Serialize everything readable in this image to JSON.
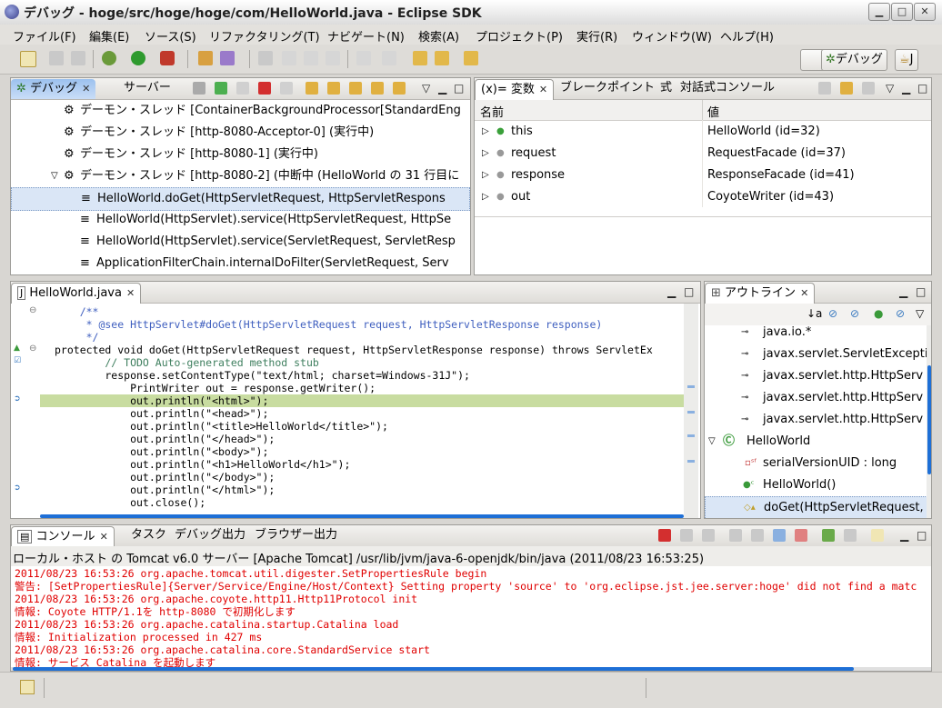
{
  "window": {
    "title": "デバッグ - hoge/src/hoge/hoge/com/HelloWorld.java - Eclipse SDK"
  },
  "menubar": [
    "ファイル(F)",
    "編集(E)",
    "ソース(S)",
    "リファクタリング(T)",
    "ナビゲート(N)",
    "検索(A)",
    "プロジェクト(P)",
    "実行(R)",
    "ウィンドウ(W)",
    "ヘルプ(H)"
  ],
  "perspectives": {
    "debug": "デバッグ",
    "java": "J"
  },
  "debug_view": {
    "tabs": [
      "デバッグ",
      "サーバー"
    ],
    "items": [
      "デーモン・スレッド [ContainerBackgroundProcessor[StandardEng",
      "デーモン・スレッド [http-8080-Acceptor-0] (実行中)",
      "デーモン・スレッド [http-8080-1] (実行中)",
      "デーモン・スレッド [http-8080-2] (中断中 (HelloWorld の 31 行目に",
      "HelloWorld.doGet(HttpServletRequest, HttpServletRespons",
      "HelloWorld(HttpServlet).service(HttpServletRequest, HttpSe",
      "HelloWorld(HttpServlet).service(ServletRequest, ServletResp",
      "ApplicationFilterChain.internalDoFilter(ServletRequest, Serv"
    ]
  },
  "variables_view": {
    "tabs": [
      "(x)= 変数",
      "ブレークポイント",
      "式",
      "対話式コンソール"
    ],
    "columns": [
      "名前",
      "値"
    ],
    "rows": [
      {
        "name": "this",
        "value": "HelloWorld  (id=32)"
      },
      {
        "name": "request",
        "value": "RequestFacade  (id=37)"
      },
      {
        "name": "response",
        "value": "ResponseFacade  (id=41)"
      },
      {
        "name": "out",
        "value": "CoyoteWriter  (id=43)"
      }
    ]
  },
  "editor": {
    "tab": "HelloWorld.java",
    "lines": [
      "    /**",
      "     * @see HttpServlet#doGet(HttpServletRequest request, HttpServletResponse response)",
      "     */",
      "protected void doGet(HttpServletRequest request, HttpServletResponse response) throws ServletEx",
      "        // TODO Auto-generated method stub",
      "        response.setContentType(\"text/html; charset=Windows-31J\");",
      "            PrintWriter out = response.getWriter();",
      "            out.println(\"<html>\");",
      "            out.println(\"<head>\");",
      "            out.println(\"<title>HelloWorld</title>\");",
      "            out.println(\"</head>\");",
      "            out.println(\"<body>\");",
      "            out.println(\"<h1>HelloWorld</h1>\");",
      "            out.println(\"</body>\");",
      "            out.println(\"</html>\");",
      "            out.close();"
    ]
  },
  "outline_view": {
    "tab": "アウトライン",
    "items": [
      "java.io.*",
      "javax.servlet.ServletExcepti",
      "javax.servlet.http.HttpServ",
      "javax.servlet.http.HttpServ",
      "javax.servlet.http.HttpServ",
      "HelloWorld",
      "serialVersionUID : long",
      "HelloWorld()",
      "doGet(HttpServletRequest,"
    ]
  },
  "console_view": {
    "tabs": [
      "コンソール",
      "タスク",
      "デバッグ出力",
      "ブラウザー出力"
    ],
    "header": "ローカル・ホスト の Tomcat v6.0 サーバー [Apache Tomcat] /usr/lib/jvm/java-6-openjdk/bin/java (2011/08/23 16:53:25)",
    "lines": [
      "2011/08/23 16:53:26 org.apache.tomcat.util.digester.SetPropertiesRule begin",
      "警告: [SetPropertiesRule]{Server/Service/Engine/Host/Context} Setting property 'source' to 'org.eclipse.jst.jee.server:hoge' did not find a matc",
      "2011/08/23 16:53:26 org.apache.coyote.http11.Http11Protocol init",
      "情報: Coyote HTTP/1.1を http-8080 で初期化します",
      "2011/08/23 16:53:26 org.apache.catalina.startup.Catalina load",
      "情報: Initialization processed in 427 ms",
      "2011/08/23 16:53:26 org.apache.catalina.core.StandardService start",
      "情報: サービス Catalina を起動します"
    ]
  },
  "colors": {
    "accent": "#9cc1ee",
    "console_text": "#e00000",
    "keyword": "#7f0055",
    "comment": "#3f5fbf",
    "string": "#2a00ff",
    "current_line": "#c8dca0"
  }
}
